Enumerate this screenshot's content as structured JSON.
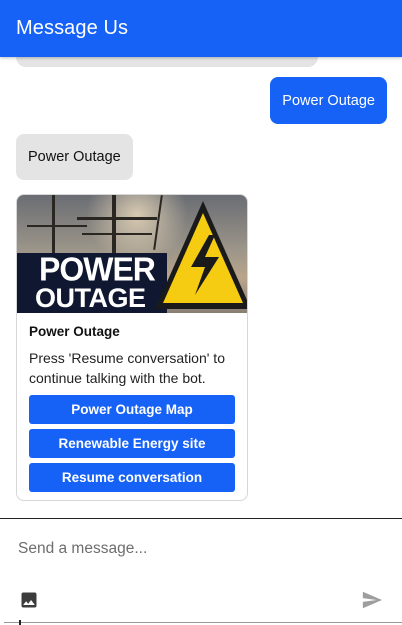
{
  "header": {
    "title": "Message Us"
  },
  "conversation": {
    "user_message": "Power Outage",
    "bot_message": "Power Outage",
    "card": {
      "image_text_line1": "POWER",
      "image_text_line2": "OUTAGE",
      "title": "Power Outage",
      "text": "Press 'Resume conversation' to continue talking with the bot.",
      "buttons": [
        {
          "label": "Power Outage Map"
        },
        {
          "label": "Renewable Energy site"
        },
        {
          "label": "Resume conversation"
        }
      ]
    }
  },
  "composer": {
    "placeholder": "Send a message...",
    "image_icon": "image-icon",
    "send_icon": "send-icon"
  },
  "colors": {
    "brand_blue": "#1662f6",
    "bubble_gray": "#e4e4e4",
    "warning_yellow": "#f5cc12"
  }
}
